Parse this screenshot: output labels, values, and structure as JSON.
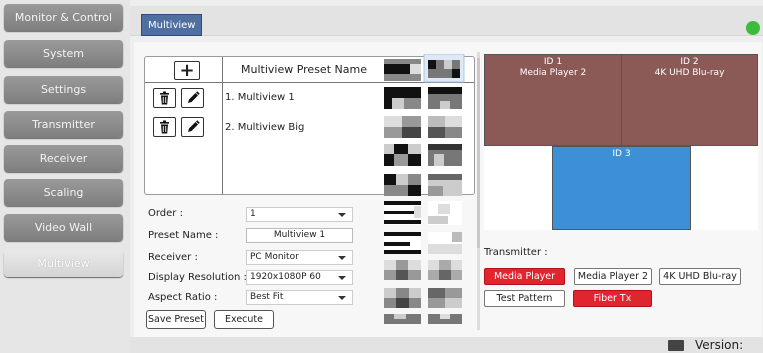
{
  "sidebar": {
    "items": [
      {
        "label": "Monitor & Control"
      },
      {
        "label": "System"
      },
      {
        "label": "Settings"
      },
      {
        "label": "Transmitter"
      },
      {
        "label": "Receiver"
      },
      {
        "label": "Scaling"
      },
      {
        "label": "Video Wall"
      },
      {
        "label": "Multiview",
        "active": true
      }
    ]
  },
  "header": {
    "tab_label": "Multiview",
    "status_color": "#3dbb3d"
  },
  "presets": {
    "column_title": "Multiview Preset Name",
    "add_icon": "plus-icon",
    "items": [
      {
        "name": "1. Multiview 1"
      },
      {
        "name": "2. Multiview Big"
      }
    ]
  },
  "form": {
    "order_label": "Order :",
    "order_value": "1",
    "preset_name_label": "Preset Name :",
    "preset_name_value": "Multiview 1",
    "receiver_label": "Receiver :",
    "receiver_value": "PC Monitor",
    "display_resolution_label": "Display Resolution :",
    "display_resolution_value": "1920x1080P 60",
    "aspect_ratio_label": "Aspect Ratio :",
    "aspect_ratio_value": "Best Fit",
    "save_label": "Save Preset",
    "execute_label": "Execute"
  },
  "preview": {
    "windows": [
      {
        "id": "ID 1",
        "source": "Media Player 2",
        "color": "#8b5a56"
      },
      {
        "id": "ID 2",
        "source": "4K UHD Blu-ray",
        "color": "#8b5a56"
      },
      {
        "id": "ID 3",
        "source": "",
        "color": "#3d8fd6"
      }
    ]
  },
  "transmitter": {
    "label": "Transmitter :",
    "buttons": [
      {
        "label": "Media Player",
        "selected": true
      },
      {
        "label": "Media Player 2",
        "selected": false
      },
      {
        "label": "4K UHD Blu-ray",
        "selected": false
      },
      {
        "label": "Test Pattern",
        "selected": false
      },
      {
        "label": "Fiber Tx",
        "selected": true
      }
    ]
  },
  "footer": {
    "version_label": "Version:"
  }
}
